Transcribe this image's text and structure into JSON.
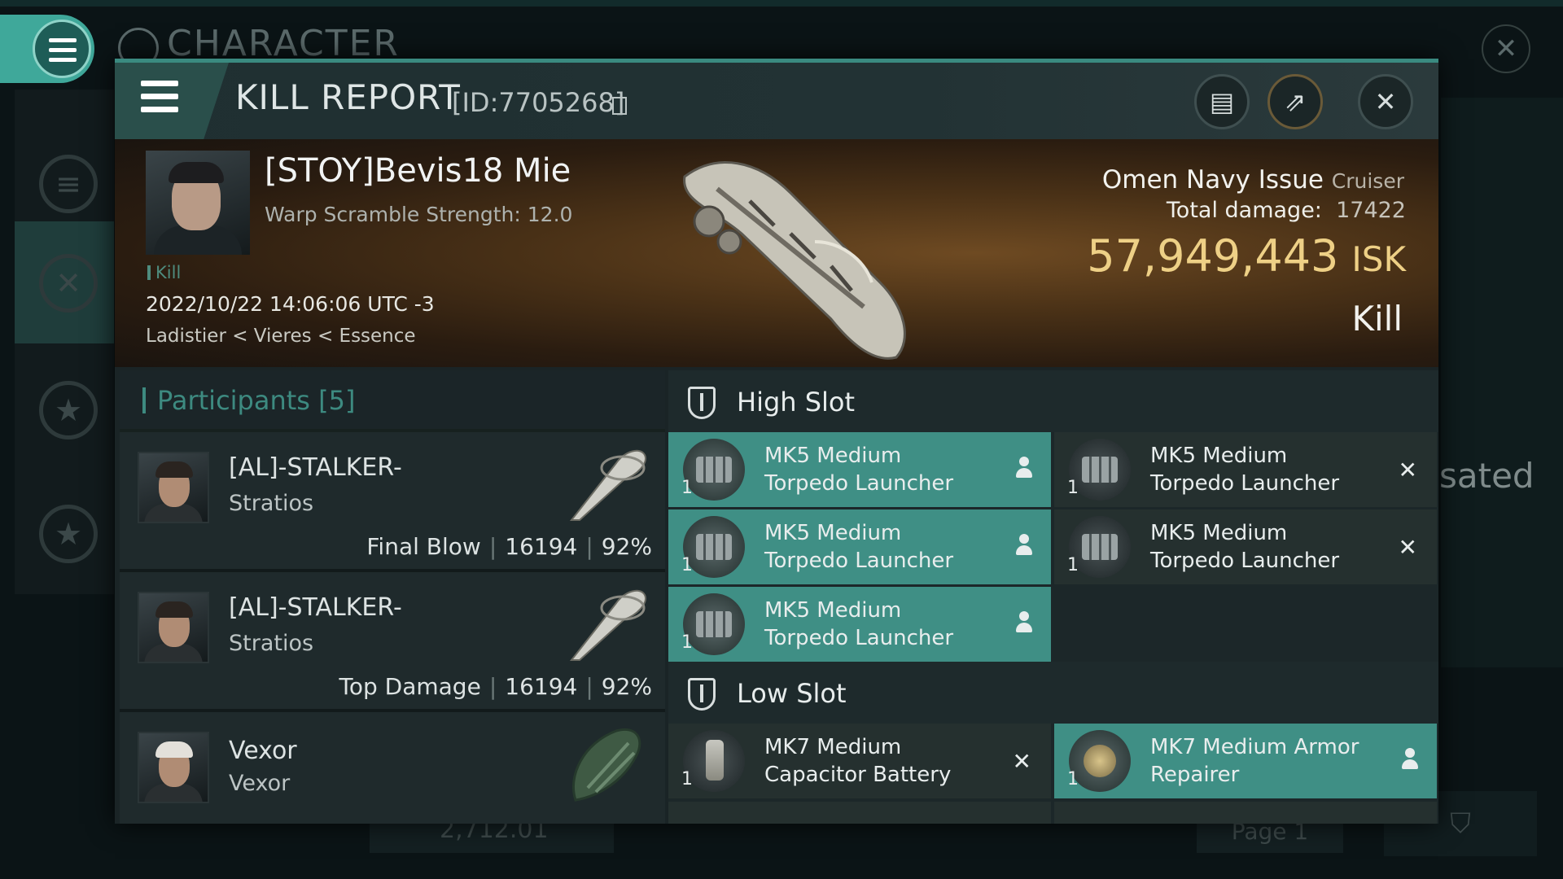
{
  "background": {
    "title": "CHARACTER",
    "side_text": "sated",
    "balance": "2,712.01",
    "page_label": "Page 1"
  },
  "header": {
    "title": "KILL REPORT",
    "id": "[ID:7705268]"
  },
  "victim": {
    "pilot": "[STOY]Bevis18 Mie",
    "warp_scramble": "Warp Scramble Strength: 12.0",
    "tag": "Kill",
    "datetime": "2022/10/22 14:06:06 UTC -3",
    "location": "Ladistier < Vieres < Essence",
    "ship_name": "Omen Navy Issue",
    "ship_class": "Cruiser",
    "total_damage_label": "Total damage:",
    "total_damage": "17422",
    "isk_value": "57,949,443",
    "isk_unit": "ISK",
    "result": "Kill"
  },
  "participants": {
    "header": "Participants [5]",
    "rows": [
      {
        "name": "[AL]-STALKER-",
        "ship": "Stratios",
        "role": "Final Blow",
        "damage": "16194",
        "percent": "92%"
      },
      {
        "name": "[AL]-STALKER-",
        "ship": "Stratios",
        "role": "Top Damage",
        "damage": "16194",
        "percent": "92%"
      },
      {
        "name": "Vexor",
        "ship": "Vexor"
      }
    ]
  },
  "fittings": {
    "high_slot_label": "High Slot",
    "low_slot_label": "Low Slot",
    "high": [
      {
        "qty": "1",
        "line1": "MK5 Medium",
        "line2": "Torpedo Launcher",
        "status": "dropped"
      },
      {
        "qty": "1",
        "line1": "MK5 Medium",
        "line2": "Torpedo Launcher",
        "status": "destroyed"
      },
      {
        "qty": "1",
        "line1": "MK5 Medium",
        "line2": "Torpedo Launcher",
        "status": "dropped"
      },
      {
        "qty": "1",
        "line1": "MK5 Medium",
        "line2": "Torpedo Launcher",
        "status": "destroyed"
      },
      {
        "qty": "1",
        "line1": "MK5 Medium",
        "line2": "Torpedo Launcher",
        "status": "dropped"
      }
    ],
    "low": [
      {
        "qty": "1",
        "line1": "MK7 Medium",
        "line2": "Capacitor Battery",
        "status": "destroyed"
      },
      {
        "qty": "1",
        "line1": "MK7 Medium Armor",
        "line2": "Repairer",
        "status": "dropped"
      }
    ],
    "status_icons": {
      "dropped": "person-icon",
      "destroyed": "x-icon"
    }
  },
  "colors": {
    "accent": "#3d8a80",
    "slot_dropped": "#3f8f85",
    "isk": "#eed086"
  }
}
